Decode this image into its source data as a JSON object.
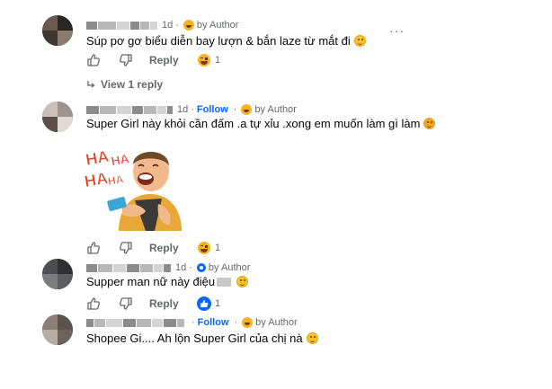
{
  "comments": [
    {
      "author_badge": "by Author",
      "time": "1d",
      "text": "Súp pơ gơ biểu diễn bay lượn & bắn laze từ mắt đi",
      "reply_label": "Reply",
      "reaction_count": "1",
      "reaction_type": "haha",
      "more_label": "···",
      "view_replies": "View 1 reply"
    },
    {
      "author_badge": "by Author",
      "time": "1d",
      "follow_label": "Follow",
      "text": "Super Girl này khỏi cần đấm .a tự xỉu .xong em muốn làm gì làm",
      "sticker_text": [
        "HA",
        "HA",
        "HA",
        "HA"
      ],
      "reply_label": "Reply",
      "reaction_count": "1",
      "reaction_type": "haha"
    },
    {
      "author_badge": "by Author",
      "time": "1d",
      "text_before": "Supper man nữ này điệu",
      "reply_label": "Reply",
      "reaction_count": "1",
      "reaction_type": "like"
    },
    {
      "author_badge": "by Author",
      "follow_label": "Follow",
      "text": "Shopee Gi.... Ah lộn Super Girl của chị nà"
    }
  ],
  "colors": {
    "follow": "#0866ff",
    "meta": "#65676b",
    "text": "#050505",
    "haha": "#f7b125",
    "like": "#0866ff"
  },
  "icons": [
    "like-icon",
    "dislike-icon",
    "reply-arrow-icon",
    "haha-reaction-icon",
    "like-reaction-icon",
    "more-icon"
  ]
}
